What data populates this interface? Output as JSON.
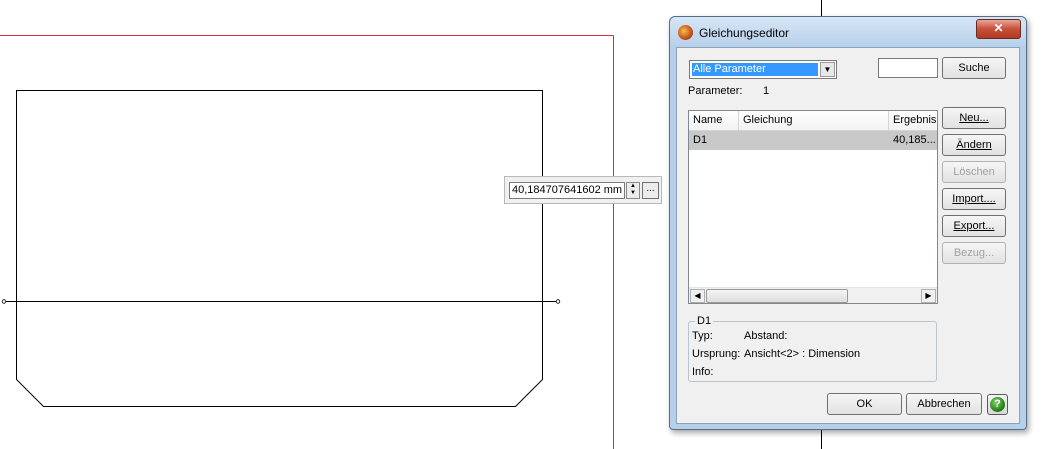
{
  "dimension_input": {
    "value": "40,184707641602 mm",
    "spin_up": "▲",
    "spin_down": "▼",
    "dots_label": "..."
  },
  "dialog": {
    "title": "Gleichungseditor",
    "close_glyph": "✕",
    "filter_selected": "Alle Parameter",
    "filter_arrow": "▼",
    "search_value": "",
    "search_button": "Suche",
    "parameter_label": "Parameter:",
    "parameter_count": "1",
    "columns": [
      "Name",
      "Gleichung",
      "Ergebnis"
    ],
    "rows": [
      {
        "name": "D1",
        "gleichung": "",
        "ergebnis": "40,185..."
      }
    ],
    "scroll_left": "◀",
    "scroll_right": "▶",
    "side_buttons": {
      "neu": "Neu...",
      "aendern": "Ändern",
      "loeschen": "Löschen",
      "import": "Import....",
      "export": "Export...",
      "bezug": "Bezug..."
    },
    "details": {
      "title": "D1",
      "typ_label": "Typ:",
      "typ_value": "Abstand:",
      "ursprung_label": "Ursprung:",
      "ursprung_value": "Ansicht<2> :  Dimension",
      "info_label": "Info:",
      "info_value": ""
    },
    "ok_button": "OK",
    "cancel_button": "Abbrechen",
    "help_glyph": "?"
  }
}
